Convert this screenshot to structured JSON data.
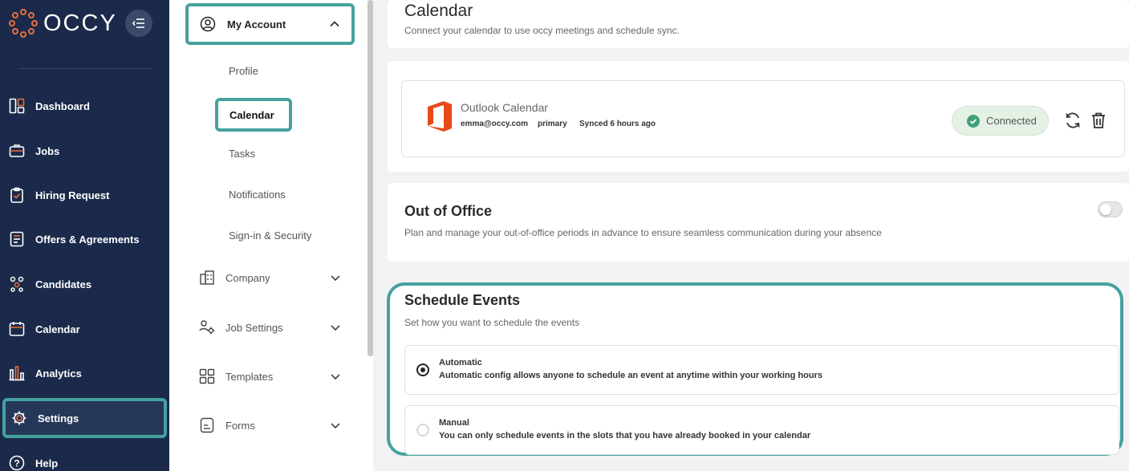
{
  "brand": {
    "name": "OCCY",
    "accent": "#45a19e",
    "nav_bg": "#1b2a4a"
  },
  "nav": {
    "items": [
      {
        "label": "Dashboard",
        "icon": "dashboard-icon"
      },
      {
        "label": "Jobs",
        "icon": "briefcase-icon"
      },
      {
        "label": "Hiring Request",
        "icon": "clipboard-check-icon"
      },
      {
        "label": "Offers & Agreements",
        "icon": "document-icon"
      },
      {
        "label": "Candidates",
        "icon": "candidates-icon"
      },
      {
        "label": "Calendar",
        "icon": "calendar-icon"
      },
      {
        "label": "Analytics",
        "icon": "analytics-icon"
      },
      {
        "label": "Settings",
        "icon": "gear-icon",
        "active": true
      },
      {
        "label": "Help",
        "icon": "help-icon"
      }
    ]
  },
  "settings_nav": {
    "account_label": "My Account",
    "links": [
      "Profile",
      "Calendar",
      "Tasks",
      "Notifications",
      "Sign-in & Security"
    ],
    "active_link": "Calendar",
    "groups": [
      "Company",
      "Job Settings",
      "Templates",
      "Forms"
    ]
  },
  "main": {
    "title": "Calendar",
    "subtitle": "Connect your calendar to use occy meetings and schedule sync.",
    "outlook": {
      "name": "Outlook Calendar",
      "email": "emma@occy.com",
      "type": "primary",
      "synced": "Synced 6 hours ago",
      "status": "Connected"
    },
    "ooo": {
      "title": "Out of Office",
      "desc": "Plan and manage your out-of-office periods in advance to ensure seamless communication during your absence",
      "enabled": false
    },
    "schedule": {
      "title": "Schedule Events",
      "desc": "Set how you want to schedule the events",
      "options": [
        {
          "title": "Automatic",
          "desc": "Automatic config allows anyone to schedule an event at anytime within your working hours",
          "selected": true
        },
        {
          "title": "Manual",
          "desc": "You can only schedule events in the slots that you have already booked in your calendar",
          "selected": false
        }
      ]
    }
  }
}
